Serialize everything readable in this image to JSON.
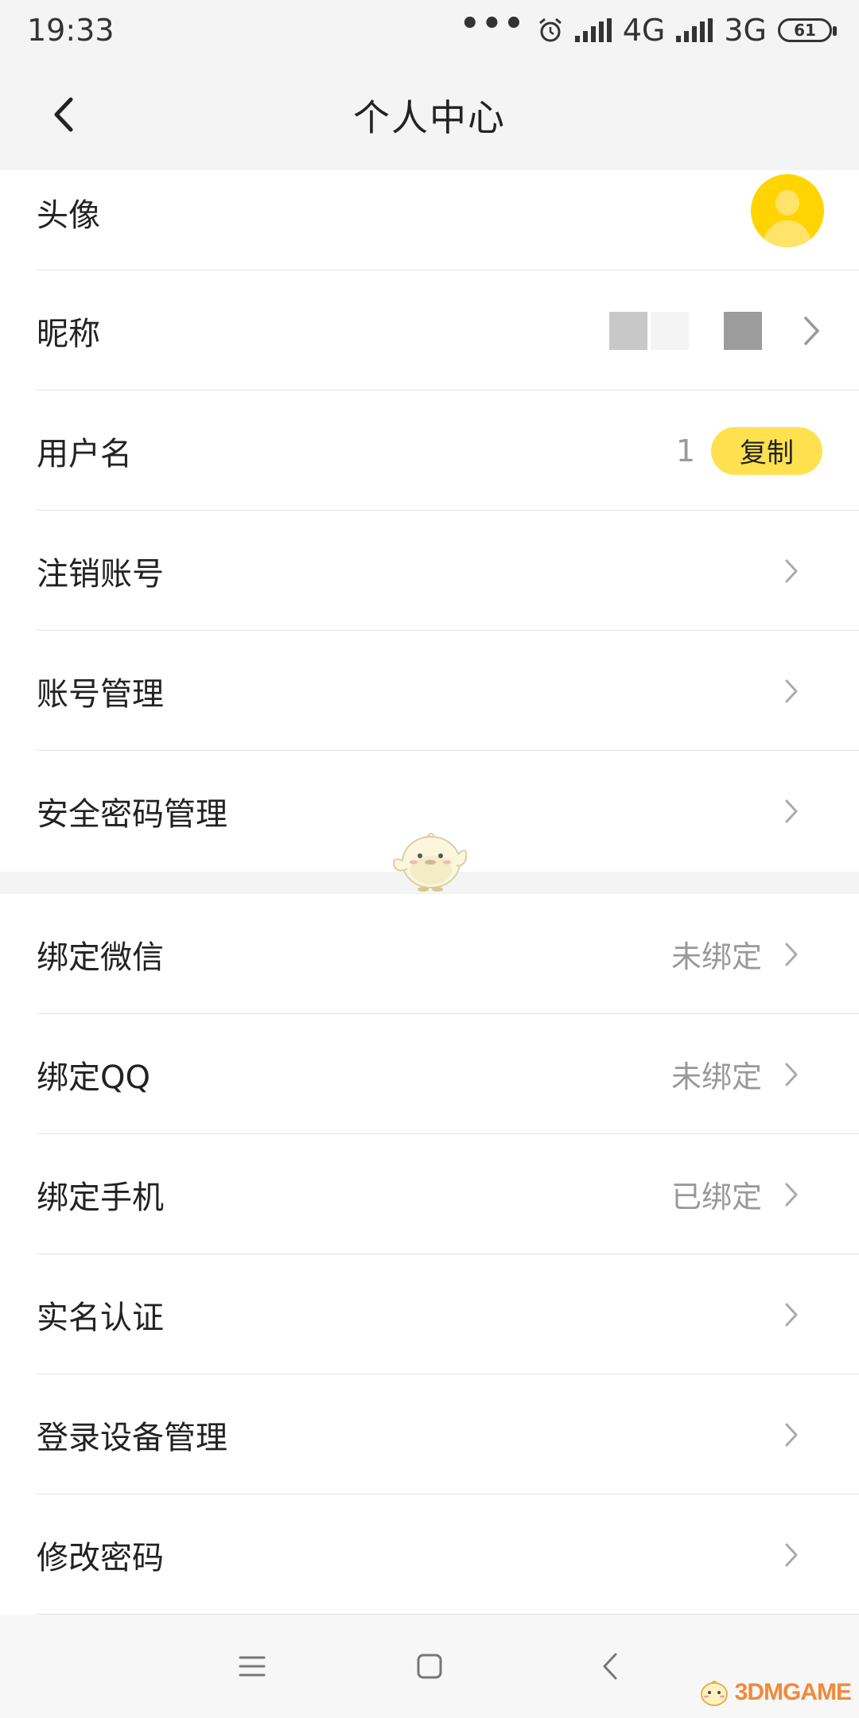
{
  "status_bar": {
    "time": "19:33",
    "network_1": "4G",
    "network_2": "3G",
    "battery": "61"
  },
  "header": {
    "title": "个人中心"
  },
  "profile": {
    "avatar_label": "头像",
    "nickname_label": "昵称",
    "username_label": "用户名",
    "username_value": "1",
    "copy_button": "复制",
    "delete_account_label": "注销账号",
    "account_manage_label": "账号管理",
    "security_password_label": "安全密码管理"
  },
  "bindings": {
    "wechat_label": "绑定微信",
    "wechat_status": "未绑定",
    "qq_label": "绑定QQ",
    "qq_status": "未绑定",
    "phone_label": "绑定手机",
    "phone_status": "已绑定",
    "realname_label": "实名认证",
    "device_manage_label": "登录设备管理",
    "change_password_label": "修改密码"
  },
  "watermark": "3DMGAME",
  "colors": {
    "accent_yellow": "#ffd400",
    "copy_button_bg": "#ffe14f",
    "header_bg": "#f4f4f4"
  }
}
